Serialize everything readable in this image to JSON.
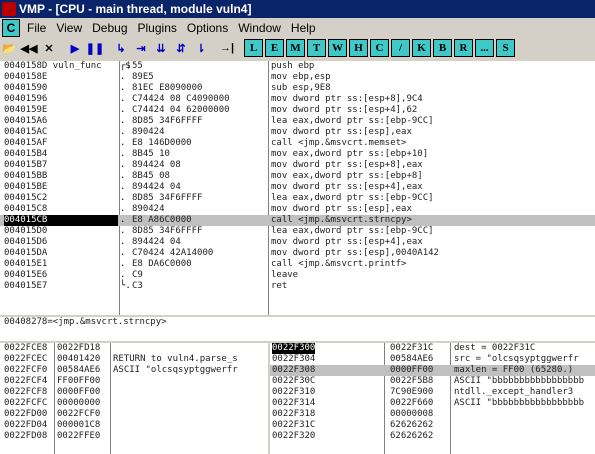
{
  "window": {
    "title": "VMP - [CPU - main thread, module vuln4]"
  },
  "menu": {
    "icon_letter": "C",
    "items": [
      "File",
      "View",
      "Debug",
      "Plugins",
      "Options",
      "Window",
      "Help"
    ]
  },
  "toolbar": {
    "buttons": [
      {
        "name": "open-icon",
        "glyph": "📂",
        "style": "dark"
      },
      {
        "name": "restart-icon",
        "glyph": "◀◀",
        "style": "dark"
      },
      {
        "name": "close-icon",
        "glyph": "✕",
        "style": "dark"
      },
      {
        "name": "run-icon",
        "glyph": "▶",
        "style": "blue"
      },
      {
        "name": "pause-icon",
        "glyph": "❚❚",
        "style": "blue"
      },
      {
        "name": "step-into-icon",
        "glyph": "↳",
        "style": "blue"
      },
      {
        "name": "step-over-icon",
        "glyph": "⇥",
        "style": "blue"
      },
      {
        "name": "trace-into-icon",
        "glyph": "⇊",
        "style": "blue"
      },
      {
        "name": "trace-over-icon",
        "glyph": "⇵",
        "style": "blue"
      },
      {
        "name": "execute-till-return-icon",
        "glyph": "⇂",
        "style": "blue"
      },
      {
        "name": "go-to-icon",
        "glyph": "→|",
        "style": "dark"
      }
    ],
    "letters": [
      "L",
      "E",
      "M",
      "T",
      "W",
      "H",
      "C",
      "/",
      "K",
      "B",
      "R",
      "...",
      "S"
    ]
  },
  "cpu": {
    "rows": [
      {
        "addr": "0040158D vuln_func",
        "arrow": "┌$",
        "hex": "55",
        "dis": "push ebp"
      },
      {
        "addr": "0040158E",
        "arrow": ".",
        "hex": "89E5",
        "dis": "mov ebp,esp"
      },
      {
        "addr": "00401590",
        "arrow": ".",
        "hex": "81EC E8090000",
        "dis": "sub esp,9E8"
      },
      {
        "addr": "00401596",
        "arrow": ".",
        "hex": "C74424 08 C4090000",
        "dis": "mov dword ptr ss:[esp+8],9C4"
      },
      {
        "addr": "0040159E",
        "arrow": ".",
        "hex": "C74424 04 62000000",
        "dis": "mov dword ptr ss:[esp+4],62"
      },
      {
        "addr": "004015A6",
        "arrow": ".",
        "hex": "8D85 34F6FFFF",
        "dis": "lea eax,dword ptr ss:[ebp-9CC]"
      },
      {
        "addr": "004015AC",
        "arrow": ".",
        "hex": "890424",
        "dis": "mov dword ptr ss:[esp],eax"
      },
      {
        "addr": "004015AF",
        "arrow": ".",
        "hex": "E8 146D0000",
        "dis": "call <jmp.&msvcrt.memset>"
      },
      {
        "addr": "004015B4",
        "arrow": ".",
        "hex": "8B45 10",
        "dis": "mov eax,dword ptr ss:[ebp+10]"
      },
      {
        "addr": "004015B7",
        "arrow": ".",
        "hex": "894424 08",
        "dis": "mov dword ptr ss:[esp+8],eax"
      },
      {
        "addr": "004015BB",
        "arrow": ".",
        "hex": "8B45 08",
        "dis": "mov eax,dword ptr ss:[ebp+8]"
      },
      {
        "addr": "004015BE",
        "arrow": ".",
        "hex": "894424 04",
        "dis": "mov dword ptr ss:[esp+4],eax"
      },
      {
        "addr": "004015C2",
        "arrow": ".",
        "hex": "8D85 34F6FFFF",
        "dis": "lea eax,dword ptr ss:[ebp-9CC]"
      },
      {
        "addr": "004015C8",
        "arrow": ".",
        "hex": "890424",
        "dis": "mov dword ptr ss:[esp],eax"
      },
      {
        "addr": "004015CB",
        "arrow": ".",
        "hex": "E8 A86C0000",
        "dis": "call <jmp.&msvcrt.strncpy>"
      },
      {
        "addr": "004015D0",
        "arrow": ".",
        "hex": "8D85 34F6FFFF",
        "dis": "lea eax,dword ptr ss:[ebp-9CC]"
      },
      {
        "addr": "004015D6",
        "arrow": ".",
        "hex": "894424 04",
        "dis": "mov dword ptr ss:[esp+4],eax"
      },
      {
        "addr": "004015DA",
        "arrow": ".",
        "hex": "C70424 42A14000",
        "dis": "mov dword ptr ss:[esp],0040A142"
      },
      {
        "addr": "004015E1",
        "arrow": ".",
        "hex": "E8 DA6C0000",
        "dis": "call <jmp.&msvcrt.printf>"
      },
      {
        "addr": "004015E6",
        "arrow": ".",
        "hex": "C9",
        "dis": "leave"
      },
      {
        "addr": "004015E7",
        "arrow": "└.",
        "hex": "C3",
        "dis": "ret"
      }
    ],
    "current_index": 14,
    "highlight_index": 14
  },
  "info": {
    "text": "00408278=<jmp.&msvcrt.strncpy>"
  },
  "dump": {
    "rows": [
      {
        "a": "0022FCE8",
        "v": "0022FD18",
        "c": ""
      },
      {
        "a": "0022FCEC",
        "v": "00401420",
        "c": "RETURN to vuln4.parse_s"
      },
      {
        "a": "0022FCF0",
        "v": "00584AE6",
        "c": "ASCII \"olcsqsyptggwerfr"
      },
      {
        "a": "0022FCF4",
        "v": "FF00FF00",
        "c": ""
      },
      {
        "a": "0022FCF8",
        "v": "0000FF00",
        "c": ""
      },
      {
        "a": "0022FCFC",
        "v": "00000000",
        "c": ""
      },
      {
        "a": "0022FD00",
        "v": "0022FCF0",
        "c": ""
      },
      {
        "a": "0022FD04",
        "v": "000001C8",
        "c": ""
      },
      {
        "a": "0022FD08",
        "v": "0022FFE0",
        "c": ""
      }
    ]
  },
  "stack": {
    "rows": [
      {
        "a": "0022F300",
        "v": "0022F31C",
        "c": "dest = 0022F31C"
      },
      {
        "a": "0022F304",
        "v": "00584AE6",
        "c": "src = \"olcsqsyptggwerfr"
      },
      {
        "a": "0022F308",
        "v": "0000FF00",
        "c": "maxlen = FF00 (65280.)"
      },
      {
        "a": "0022F30C",
        "v": "0022F5B8",
        "c": "ASCII \"bbbbbbbbbbbbbbbbb"
      },
      {
        "a": "0022F310",
        "v": "7C90E900",
        "c": "ntdll._except_handler3"
      },
      {
        "a": "0022F314",
        "v": "0022F660",
        "c": "ASCII \"bbbbbbbbbbbbbbbbb"
      },
      {
        "a": "0022F318",
        "v": "00000008",
        "c": ""
      },
      {
        "a": "0022F31C",
        "v": "62626262",
        "c": ""
      },
      {
        "a": "0022F320",
        "v": "62626262",
        "c": ""
      }
    ],
    "selected_index": 0,
    "highlight_index": 2
  }
}
